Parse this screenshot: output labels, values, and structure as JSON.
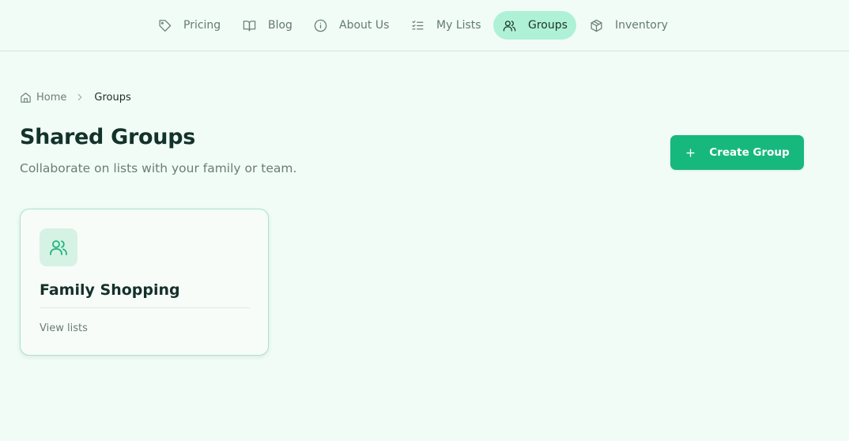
{
  "nav": {
    "items": [
      {
        "label": "Pricing",
        "icon": "tag-icon"
      },
      {
        "label": "Blog",
        "icon": "book-icon"
      },
      {
        "label": "About Us",
        "icon": "info-icon"
      },
      {
        "label": "My Lists",
        "icon": "list-checks-icon"
      },
      {
        "label": "Groups",
        "icon": "users-icon",
        "active": true
      },
      {
        "label": "Inventory",
        "icon": "box-icon"
      }
    ]
  },
  "breadcrumb": {
    "home": "Home",
    "current": "Groups"
  },
  "header": {
    "title": "Shared Groups",
    "subtitle": "Collaborate on lists with your family or team.",
    "create_button": "Create Group"
  },
  "groups": [
    {
      "name": "Family Shopping",
      "link": "View lists",
      "icon": "users-icon"
    }
  ],
  "colors": {
    "background": "#f1fcf6",
    "accent": "#17b87e",
    "active_nav": "#aef1d7"
  }
}
